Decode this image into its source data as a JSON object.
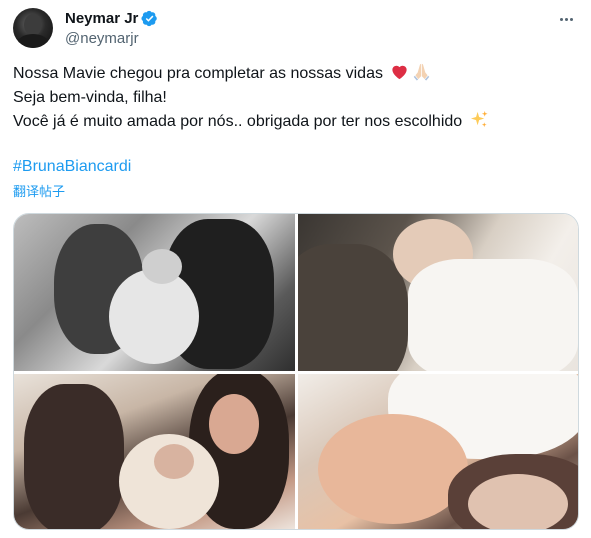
{
  "author": {
    "display_name": "Neymar Jr",
    "handle": "@neymarjr",
    "verified": true,
    "verified_color": "#1d9bf0"
  },
  "tweet": {
    "line1": "Nossa Mavie chegou pra completar as nossas vidas",
    "line1_emojis": [
      "red-heart",
      "folded-hands"
    ],
    "line2": "Seja bem-vinda, filha!",
    "line3": "Você já é muito amada por nós.. obrigada por ter nos escolhido",
    "line3_emojis": [
      "sparkles"
    ],
    "hashtag": "#BrunaBiancardi",
    "translate_label": "翻译帖子"
  },
  "media": {
    "photos": [
      {
        "name": "couple-kissing-newborn-bw"
      },
      {
        "name": "newborn-in-white-blanket"
      },
      {
        "name": "family-portrait-with-baby"
      },
      {
        "name": "newborn-with-maternity-hat"
      }
    ]
  },
  "icons": {
    "more": "more-options-icon",
    "verified": "verified-badge-icon"
  },
  "colors": {
    "link": "#1d9bf0",
    "text": "#0f1419",
    "secondary": "#536471",
    "border": "#cfd9de"
  }
}
